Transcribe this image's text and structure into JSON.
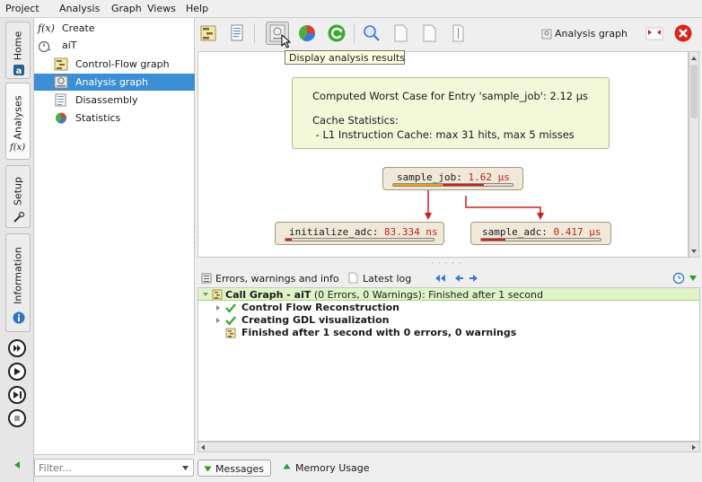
{
  "menu": [
    "Project",
    "Analysis",
    "Graph",
    "Views",
    "Help"
  ],
  "vertical_tabs": {
    "home": "Home",
    "analyses": "Analyses",
    "fx": "f(x)",
    "setup": "Setup",
    "information": "Information"
  },
  "tree": {
    "create": "Create",
    "ait": "aiT",
    "items": [
      "Control-Flow graph",
      "Analysis graph",
      "Disassembly",
      "Statistics"
    ],
    "fx_glyph": "f(x)"
  },
  "filter": {
    "placeholder": "Filter..."
  },
  "toolbar": {
    "tooltip": "Display analysis results",
    "view_label": "Analysis graph"
  },
  "graph": {
    "result_line1": "Computed Worst Case for Entry 'sample_job': 2.12 µs",
    "result_line2": "Cache Statistics:",
    "result_line3": " - L1 Instruction Cache: max 31 hits, max 5 misses",
    "nodes": [
      {
        "name": "sample_job:",
        "value": "1.62 µs",
        "fraction": 0.76,
        "fill_color": "#cc1f1f",
        "accent_color": "#f0a020"
      },
      {
        "name": "initialize_adc:",
        "value": "83.334 ns",
        "fraction": 0.04,
        "fill_color": "#cc1f1f"
      },
      {
        "name": "sample_adc:",
        "value": "0.417 µs",
        "fraction": 0.2,
        "fill_color": "#cc1f1f"
      }
    ],
    "edge_color": "#cc1f1f"
  },
  "messages": {
    "tab_errors": "Errors, warnings and info",
    "tab_latest": "Latest log",
    "line1_bold": "Call Graph - aiT",
    "line1_rest": "(0 Errors, 0 Warnings): Finished after 1 second",
    "line2": "Control Flow Reconstruction",
    "line3": "Creating GDL visualization",
    "line4": "Finished after 1 second with 0 errors, 0 warnings"
  },
  "bottom_tabs": {
    "messages": "Messages",
    "memory": "Memory Usage"
  },
  "colors": {
    "selection": "#3c8fd4",
    "success": "#3aa830",
    "error": "#d9261c",
    "accent": "#cc1f1f"
  }
}
